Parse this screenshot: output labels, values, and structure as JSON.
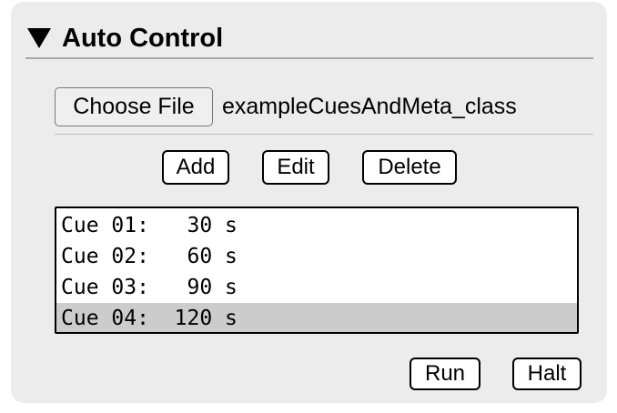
{
  "panel": {
    "title": "Auto Control",
    "collapse_icon": "triangle-down-icon"
  },
  "file": {
    "choose_label": "Choose File",
    "file_name": "exampleCuesAndMeta_class"
  },
  "actions": {
    "add_label": "Add",
    "edit_label": "Edit",
    "delete_label": "Delete"
  },
  "cues": [
    {
      "text": "Cue 01:   30 s",
      "selected": false
    },
    {
      "text": "Cue 02:   60 s",
      "selected": false
    },
    {
      "text": "Cue 03:   90 s",
      "selected": false
    },
    {
      "text": "Cue 04:  120 s",
      "selected": true
    }
  ],
  "controls": {
    "run_label": "Run",
    "halt_label": "Halt"
  },
  "colors": {
    "panel_bg": "#ececec",
    "selection_bg": "#cccccc"
  }
}
